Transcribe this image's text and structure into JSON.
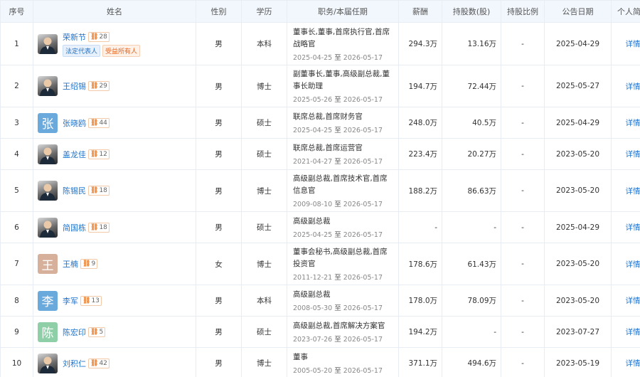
{
  "headers": [
    "序号",
    "姓名",
    "性别",
    "学历",
    "职务/本届任期",
    "薪酬",
    "持股数(股)",
    "持股比例",
    "公告日期",
    "个人简介"
  ],
  "detail_label": "详情",
  "term_sep": "至",
  "rows": [
    {
      "no": "1",
      "name": "荣新节",
      "badge": "28",
      "avatar": "photo",
      "avatar_char": "",
      "avatar_color": "",
      "tags": [
        "法定代表人",
        "受益所有人"
      ],
      "gender": "男",
      "edu": "本科",
      "role": "董事长,董事,首席执行官,首席战略官",
      "start": "2025-04-25",
      "end": "2026-05-17",
      "salary": "294.3万",
      "shares": "13.16万",
      "ratio": "-",
      "date": "2025-04-29"
    },
    {
      "no": "2",
      "name": "王绍锡",
      "badge": "29",
      "avatar": "photo",
      "avatar_char": "",
      "avatar_color": "",
      "tags": [],
      "gender": "男",
      "edu": "博士",
      "role": "副董事长,董事,高级副总裁,董事长助理",
      "start": "2025-05-26",
      "end": "2026-05-17",
      "salary": "194.7万",
      "shares": "72.44万",
      "ratio": "-",
      "date": "2025-05-27"
    },
    {
      "no": "3",
      "name": "张晓鸥",
      "badge": "44",
      "avatar": "letter",
      "avatar_char": "张",
      "avatar_color": "#6aa9dc",
      "tags": [],
      "gender": "男",
      "edu": "硕士",
      "role": "联席总裁,首席财务官",
      "start": "2025-04-25",
      "end": "2026-05-17",
      "salary": "248.0万",
      "shares": "40.5万",
      "ratio": "-",
      "date": "2025-04-29"
    },
    {
      "no": "4",
      "name": "盖龙佳",
      "badge": "12",
      "avatar": "photo",
      "avatar_char": "",
      "avatar_color": "",
      "tags": [],
      "gender": "男",
      "edu": "硕士",
      "role": "联席总裁,首席运营官",
      "start": "2021-04-27",
      "end": "2026-05-17",
      "salary": "223.4万",
      "shares": "20.27万",
      "ratio": "-",
      "date": "2023-05-20"
    },
    {
      "no": "5",
      "name": "陈锡民",
      "badge": "18",
      "avatar": "photo",
      "avatar_char": "",
      "avatar_color": "",
      "tags": [],
      "gender": "男",
      "edu": "博士",
      "role": "高级副总裁,首席技术官,首席信息官",
      "start": "2009-08-10",
      "end": "2026-05-17",
      "salary": "188.2万",
      "shares": "86.63万",
      "ratio": "-",
      "date": "2023-05-20"
    },
    {
      "no": "6",
      "name": "简国栋",
      "badge": "18",
      "avatar": "photo",
      "avatar_char": "",
      "avatar_color": "",
      "tags": [],
      "gender": "男",
      "edu": "硕士",
      "role": "高级副总裁",
      "start": "2025-04-25",
      "end": "2026-05-17",
      "salary": "-",
      "shares": "-",
      "ratio": "-",
      "date": "2025-04-29"
    },
    {
      "no": "7",
      "name": "王楠",
      "badge": "9",
      "avatar": "letter",
      "avatar_char": "王",
      "avatar_color": "#d6b09b",
      "tags": [],
      "gender": "女",
      "edu": "博士",
      "role": "董事会秘书,高级副总裁,首席投资官",
      "start": "2011-12-21",
      "end": "2026-05-17",
      "salary": "178.6万",
      "shares": "61.43万",
      "ratio": "-",
      "date": "2023-05-20"
    },
    {
      "no": "8",
      "name": "李军",
      "badge": "13",
      "avatar": "letter",
      "avatar_char": "李",
      "avatar_color": "#6aa9dc",
      "tags": [],
      "gender": "男",
      "edu": "本科",
      "role": "高级副总裁",
      "start": "2008-05-30",
      "end": "2026-05-17",
      "salary": "178.0万",
      "shares": "78.09万",
      "ratio": "-",
      "date": "2023-05-20"
    },
    {
      "no": "9",
      "name": "陈宏印",
      "badge": "5",
      "avatar": "letter",
      "avatar_char": "陈",
      "avatar_color": "#8fcfa8",
      "tags": [],
      "gender": "男",
      "edu": "硕士",
      "role": "高级副总裁,首席解决方案官",
      "start": "2023-07-26",
      "end": "2026-05-17",
      "salary": "194.2万",
      "shares": "-",
      "ratio": "-",
      "date": "2023-07-27"
    },
    {
      "no": "10",
      "name": "刘积仁",
      "badge": "42",
      "avatar": "photo",
      "avatar_char": "",
      "avatar_color": "",
      "tags": [],
      "gender": "男",
      "edu": "博士",
      "role": "董事",
      "start": "2005-05-20",
      "end": "2026-05-17",
      "salary": "371.1万",
      "shares": "494.6万",
      "ratio": "-",
      "date": "2023-05-19"
    }
  ]
}
